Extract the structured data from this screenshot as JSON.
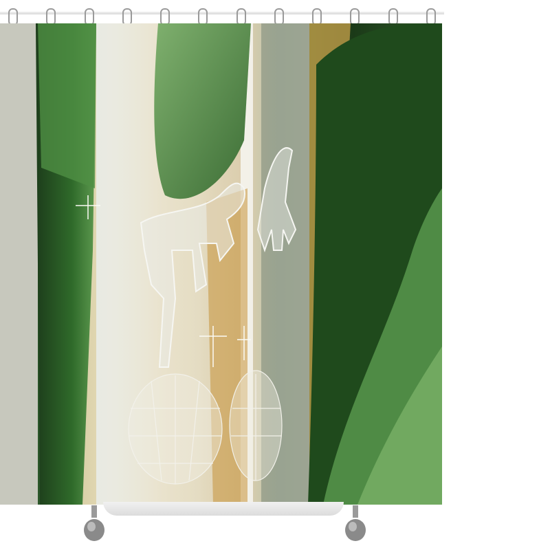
{
  "scene": {
    "subject": "shower curtain",
    "palette": {
      "leaf_green": "#3f7a3b",
      "dark_green": "#173515",
      "glass": "#d9dfe0",
      "amber": "#c9a24b",
      "rod": "#e4e4e4",
      "foot_metal": "#8e8e8e"
    },
    "ring_count": 12
  }
}
